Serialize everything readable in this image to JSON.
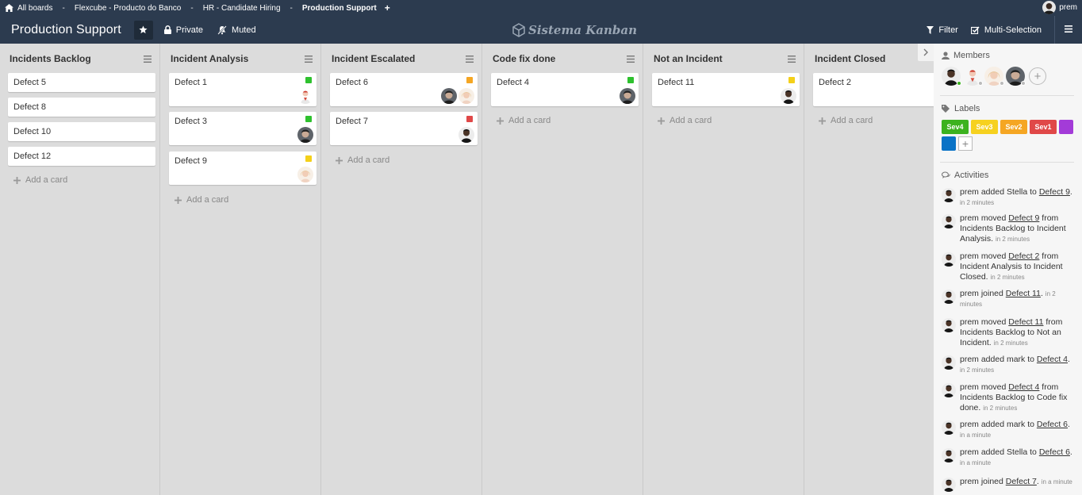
{
  "topbar": {
    "crumbs": [
      "All boards",
      "Flexcube - Producto do Banco",
      "HR - Candidate Hiring",
      "Production Support"
    ],
    "username": "prem"
  },
  "header": {
    "board_title": "Production Support",
    "private_label": "Private",
    "muted_label": "Muted",
    "brand": "Sistema Kanban",
    "filter_label": "Filter",
    "multiselect_label": "Multi-Selection"
  },
  "lists": [
    {
      "title": "Incidents Backlog",
      "cards": [
        {
          "title": "Defect 5"
        },
        {
          "title": "Defect 8"
        },
        {
          "title": "Defect 10"
        },
        {
          "title": "Defect 12"
        }
      ],
      "add_card": "Add a card"
    },
    {
      "title": "Incident Analysis",
      "cards": [
        {
          "title": "Defect 1",
          "label": "#2ec12e",
          "members": [
            "mark"
          ]
        },
        {
          "title": "Defect 3",
          "label": "#2ec12e",
          "members": [
            "dark-hair"
          ]
        },
        {
          "title": "Defect 9",
          "label": "#f4d019",
          "members": [
            "stella"
          ]
        }
      ],
      "add_card": "Add a card"
    },
    {
      "title": "Incident Escalated",
      "cards": [
        {
          "title": "Defect 6",
          "label": "#f5a623",
          "members": [
            "dark-hair",
            "stella"
          ]
        },
        {
          "title": "Defect 7",
          "label": "#e04848",
          "members": [
            "prem"
          ]
        }
      ],
      "add_card": "Add a card"
    },
    {
      "title": "Code fix done",
      "cards": [
        {
          "title": "Defect 4",
          "label": "#2ec12e",
          "members": [
            "dark-hair"
          ]
        }
      ],
      "add_card": "Add a card"
    },
    {
      "title": "Not an Incident",
      "cards": [
        {
          "title": "Defect 11",
          "label": "#f4d019",
          "members": [
            "prem"
          ]
        }
      ],
      "add_card": "Add a card"
    },
    {
      "title": "Incident Closed",
      "cards": [
        {
          "title": "Defect 2"
        }
      ],
      "add_card": "Add a card"
    }
  ],
  "sidebar": {
    "members_title": "Members",
    "labels_title": "Labels",
    "labels": [
      {
        "name": "Sev4",
        "color": "#3cb21f"
      },
      {
        "name": "Sev3",
        "color": "#f6d11f"
      },
      {
        "name": "Sev2",
        "color": "#f5a623"
      },
      {
        "name": "Sev1",
        "color": "#e04848"
      },
      {
        "name": "",
        "color": "#a33bd8"
      },
      {
        "name": "",
        "color": "#0a73c6"
      }
    ],
    "activities_title": "Activities",
    "activities": [
      {
        "pre": "prem added Stella to ",
        "link": "Defect 9",
        "post": ".",
        "time": "in 2 minutes"
      },
      {
        "pre": "prem moved ",
        "link": "Defect 9",
        "post": " from Incidents Backlog to Incident Analysis.",
        "time": "in 2 minutes"
      },
      {
        "pre": "prem moved ",
        "link": "Defect 2",
        "post": " from Incident Analysis to Incident Closed.",
        "time": "in 2 minutes"
      },
      {
        "pre": "prem joined ",
        "link": "Defect 11",
        "post": ".",
        "time": "in 2 minutes"
      },
      {
        "pre": "prem moved ",
        "link": "Defect 11",
        "post": " from Incidents Backlog to Not an Incident.",
        "time": "in 2 minutes"
      },
      {
        "pre": "prem added mark to ",
        "link": "Defect 4",
        "post": ".",
        "time": "in 2 minutes"
      },
      {
        "pre": "prem moved ",
        "link": "Defect 4",
        "post": " from Incidents Backlog to Code fix done.",
        "time": "in 2 minutes"
      },
      {
        "pre": "prem added mark to ",
        "link": "Defect 6",
        "post": ".",
        "time": "in a minute"
      },
      {
        "pre": "prem added Stella to ",
        "link": "Defect 6",
        "post": ".",
        "time": "in a minute"
      },
      {
        "pre": "prem joined ",
        "link": "Defect 7",
        "post": ".",
        "time": "in a minute"
      }
    ]
  }
}
